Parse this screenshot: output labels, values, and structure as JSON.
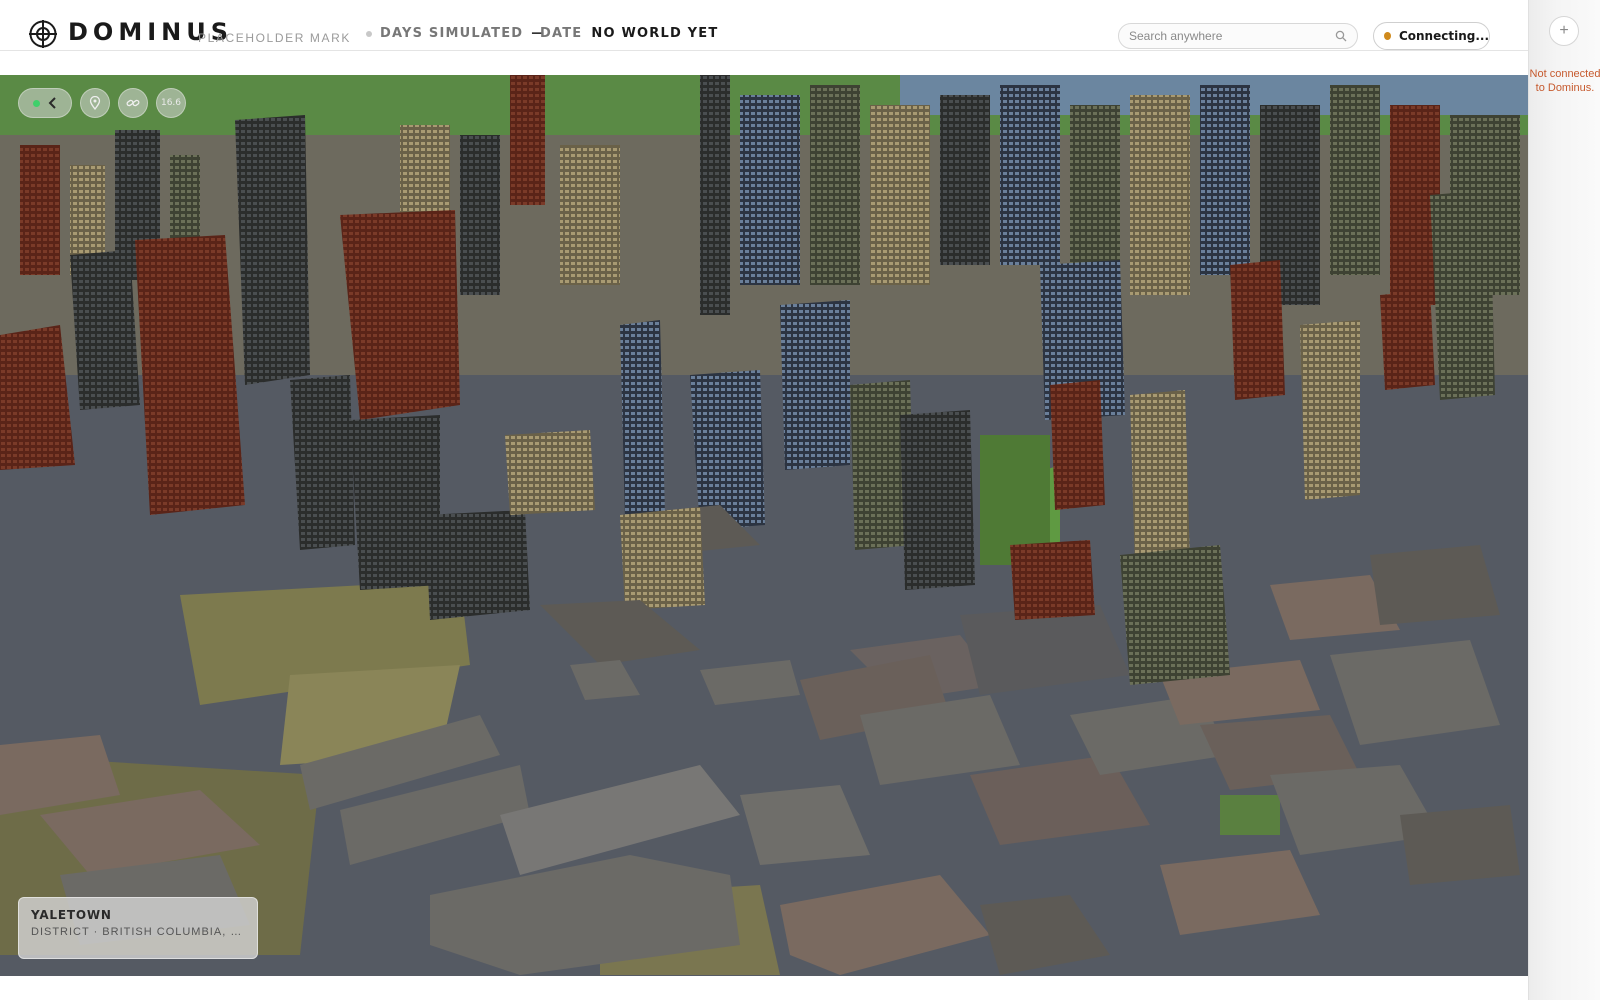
{
  "header": {
    "brand": "DOMINUS",
    "brand_sub": "PLACEHOLDER MARK",
    "days_label": "DAYS SIMULATED",
    "days_value": "—",
    "date_label": "DATE",
    "date_value": "NO WORLD YET"
  },
  "search": {
    "placeholder": "Search anywhere"
  },
  "connection": {
    "label": "Connecting...",
    "status_color": "#d08a1c"
  },
  "rail": {
    "add_label": "+",
    "status": "Not connected to Dominus."
  },
  "viewport_toolbar": {
    "zoom": "16.6"
  },
  "location": {
    "name": "YALETOWN",
    "subtitle": "DISTRICT · BRITISH COLUMBIA, CA..."
  },
  "icons": [
    "logo-mark-icon",
    "search-icon",
    "chevron-left-icon",
    "pin-icon",
    "link-icon"
  ]
}
